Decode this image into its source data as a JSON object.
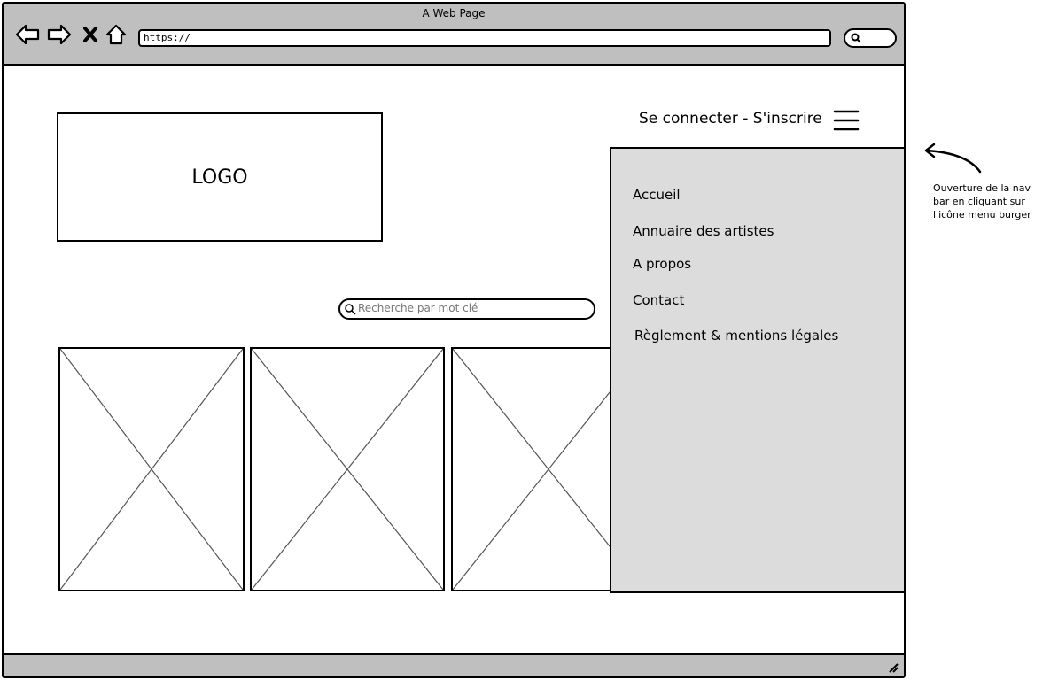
{
  "browser": {
    "title": "A Web Page",
    "url": "https://"
  },
  "header": {
    "logo": "LOGO",
    "auth_link": "Se connecter  - S'inscrire"
  },
  "search": {
    "placeholder": "Recherche par mot clé"
  },
  "nav": {
    "items": [
      {
        "label": "Accueil"
      },
      {
        "label": "Annuaire des artistes"
      },
      {
        "label": "A propos"
      },
      {
        "label": "Contact"
      },
      {
        "label": "Règlement & mentions légales"
      }
    ]
  },
  "annotation": {
    "lines": [
      "Ouverture de la nav",
      "bar en cliquant sur",
      "l'icône menu burger"
    ]
  },
  "gallery": {
    "count": 3
  }
}
